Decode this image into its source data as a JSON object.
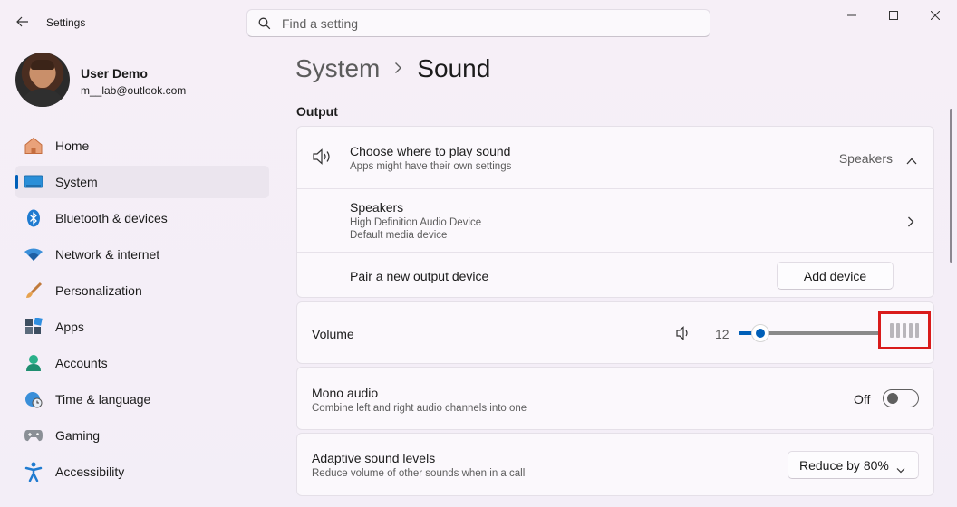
{
  "window": {
    "title": "Settings"
  },
  "search": {
    "placeholder": "Find a setting"
  },
  "user": {
    "name": "User Demo",
    "email": "m__lab@outlook.com"
  },
  "nav": [
    {
      "label": "Home",
      "icon": "home-icon",
      "active": false
    },
    {
      "label": "System",
      "icon": "system-icon",
      "active": true
    },
    {
      "label": "Bluetooth & devices",
      "icon": "bluetooth-icon",
      "active": false
    },
    {
      "label": "Network & internet",
      "icon": "wifi-icon",
      "active": false
    },
    {
      "label": "Personalization",
      "icon": "brush-icon",
      "active": false
    },
    {
      "label": "Apps",
      "icon": "apps-icon",
      "active": false
    },
    {
      "label": "Accounts",
      "icon": "accounts-icon",
      "active": false
    },
    {
      "label": "Time & language",
      "icon": "clock-globe-icon",
      "active": false
    },
    {
      "label": "Gaming",
      "icon": "gamepad-icon",
      "active": false
    },
    {
      "label": "Accessibility",
      "icon": "accessibility-icon",
      "active": false
    }
  ],
  "breadcrumb": {
    "parent": "System",
    "current": "Sound"
  },
  "output": {
    "section_title": "Output",
    "choose": {
      "title": "Choose where to play sound",
      "subtitle": "Apps might have their own settings",
      "value": "Speakers"
    },
    "speakers": {
      "title": "Speakers",
      "line1": "High Definition Audio Device",
      "line2": "Default media device"
    },
    "pair": {
      "title": "Pair a new output device",
      "button": "Add device"
    }
  },
  "volume": {
    "label": "Volume",
    "value": "12",
    "fraction": 0.12
  },
  "mono": {
    "title": "Mono audio",
    "subtitle": "Combine left and right audio channels into one",
    "state": "Off"
  },
  "adaptive": {
    "title": "Adaptive sound levels",
    "subtitle": "Reduce volume of other sounds when in a call",
    "selected": "Reduce by 80%"
  },
  "colors": {
    "accent": "#005fb8",
    "highlight": "#d91b1b"
  }
}
